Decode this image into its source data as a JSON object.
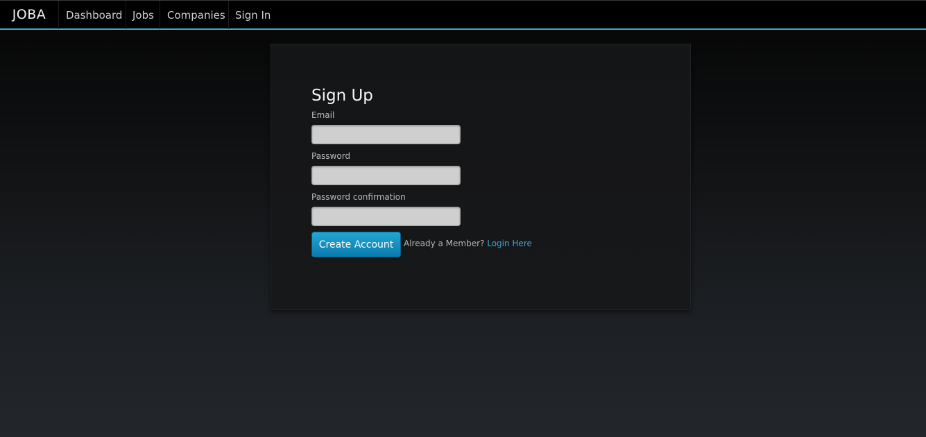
{
  "nav": {
    "brand": "JOBA",
    "items": [
      {
        "label": "Dashboard"
      },
      {
        "label": "Jobs"
      },
      {
        "label": "Companies"
      },
      {
        "label": "Sign In"
      }
    ]
  },
  "form": {
    "title": "Sign Up",
    "fields": [
      {
        "label": "Email",
        "value": "",
        "placeholder": ""
      },
      {
        "label": "Password",
        "value": "",
        "placeholder": ""
      },
      {
        "label": "Password confirmation",
        "value": "",
        "placeholder": ""
      }
    ],
    "submit_label": "Create Account",
    "member_prompt": "Already a Member?",
    "login_link": "Login Here"
  },
  "colors": {
    "accent": "#4aa3c8",
    "button": "#1591c4",
    "link": "#3fa7db"
  }
}
